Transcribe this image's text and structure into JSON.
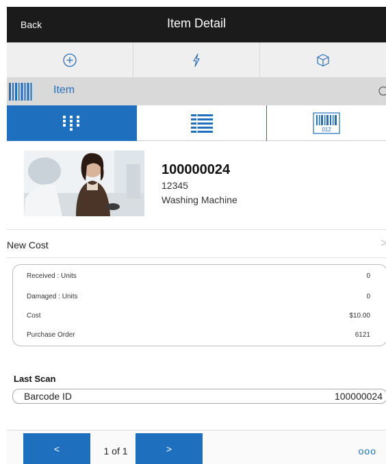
{
  "header": {
    "back_label": "Back",
    "title": "Item Detail"
  },
  "action_bar": {
    "items": [
      {
        "icon": "plus-circle-icon"
      },
      {
        "icon": "lightning-icon"
      },
      {
        "icon": "box-icon"
      }
    ]
  },
  "scan": {
    "icon": "barcode-icon",
    "value": "Item",
    "search_icon": "search-icon"
  },
  "view_tabs": {
    "active_index": 0,
    "items": [
      {
        "icon": "grid-view-icon"
      },
      {
        "icon": "list-view-icon"
      },
      {
        "icon": "barcode-view-icon",
        "caption": "012"
      }
    ]
  },
  "item": {
    "number": "100000024",
    "code": "12345",
    "description": "Washing Machine"
  },
  "new_cost": {
    "label": "New Cost",
    "chevron": ">"
  },
  "details": [
    {
      "label": "Received : Units",
      "value": "0"
    },
    {
      "label": "Damaged : Units",
      "value": "0"
    },
    {
      "label": "Cost",
      "value": "$10.00"
    },
    {
      "label": "Purchase Order",
      "value": "6121"
    }
  ],
  "last_scan": {
    "heading": "Last Scan",
    "label": "Barcode ID",
    "value": "100000024"
  },
  "footer": {
    "prev_label": "<",
    "next_label": ">",
    "page_info": "1 of 1",
    "more_label": "ooo"
  },
  "colors": {
    "accent": "#1f6fbf",
    "title_bar": "#1b1b1b",
    "action_bar": "#efefef",
    "scan_bar": "#d9d9d9"
  }
}
